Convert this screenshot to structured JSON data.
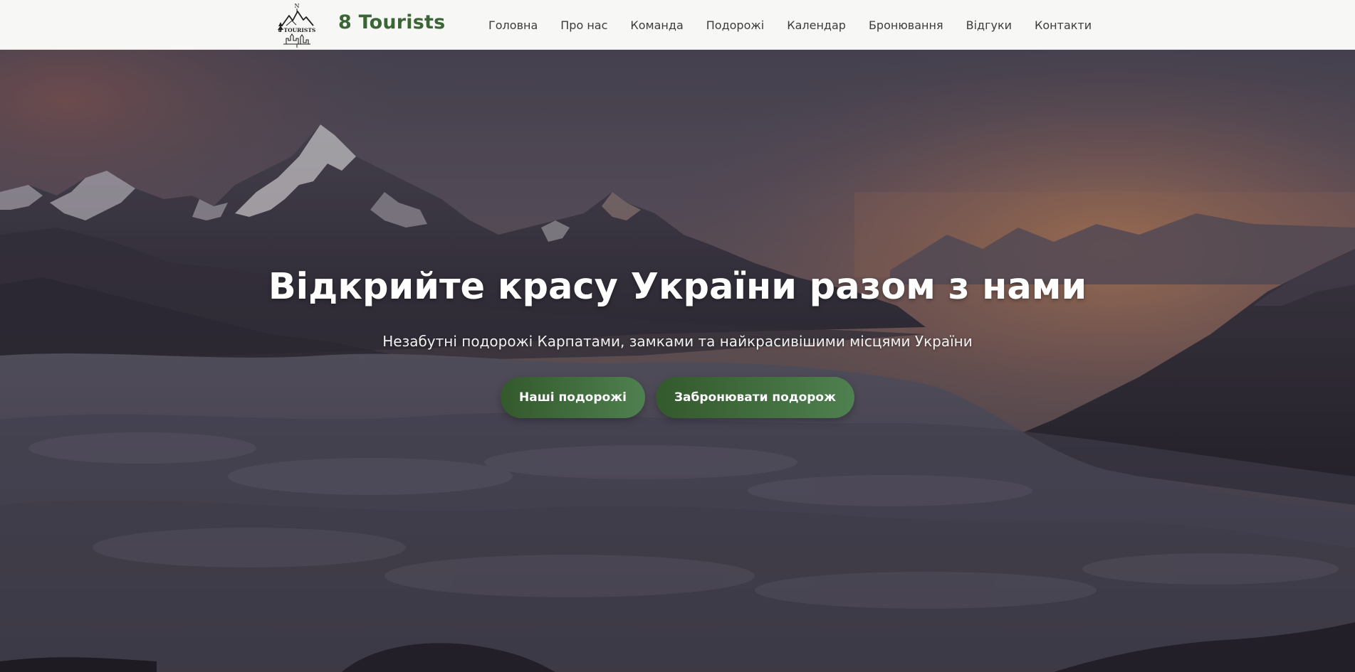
{
  "header": {
    "logo_text": "8 TOURISTS",
    "logo_compass": "N",
    "brand": "8 Tourists",
    "nav": [
      {
        "label": "Головна"
      },
      {
        "label": "Про нас"
      },
      {
        "label": "Команда"
      },
      {
        "label": "Подорожі"
      },
      {
        "label": "Календар"
      },
      {
        "label": "Бронювання"
      },
      {
        "label": "Відгуки"
      },
      {
        "label": "Контакти"
      }
    ]
  },
  "hero": {
    "title": "Відкрийте красу України разом з нами",
    "subtitle": "Незабутні подорожі Карпатами, замками та найкрасивішими місцями України",
    "primary_button": "Наші подорожі",
    "secondary_button": "Забронювати подорож"
  },
  "colors": {
    "brand_green": "#3a6534",
    "button_green_dark": "#33592c",
    "button_green_light": "#4f8050",
    "header_bg": "#f7f7f5"
  },
  "icons": {
    "logo": "mountain-compass-logo-icon"
  }
}
